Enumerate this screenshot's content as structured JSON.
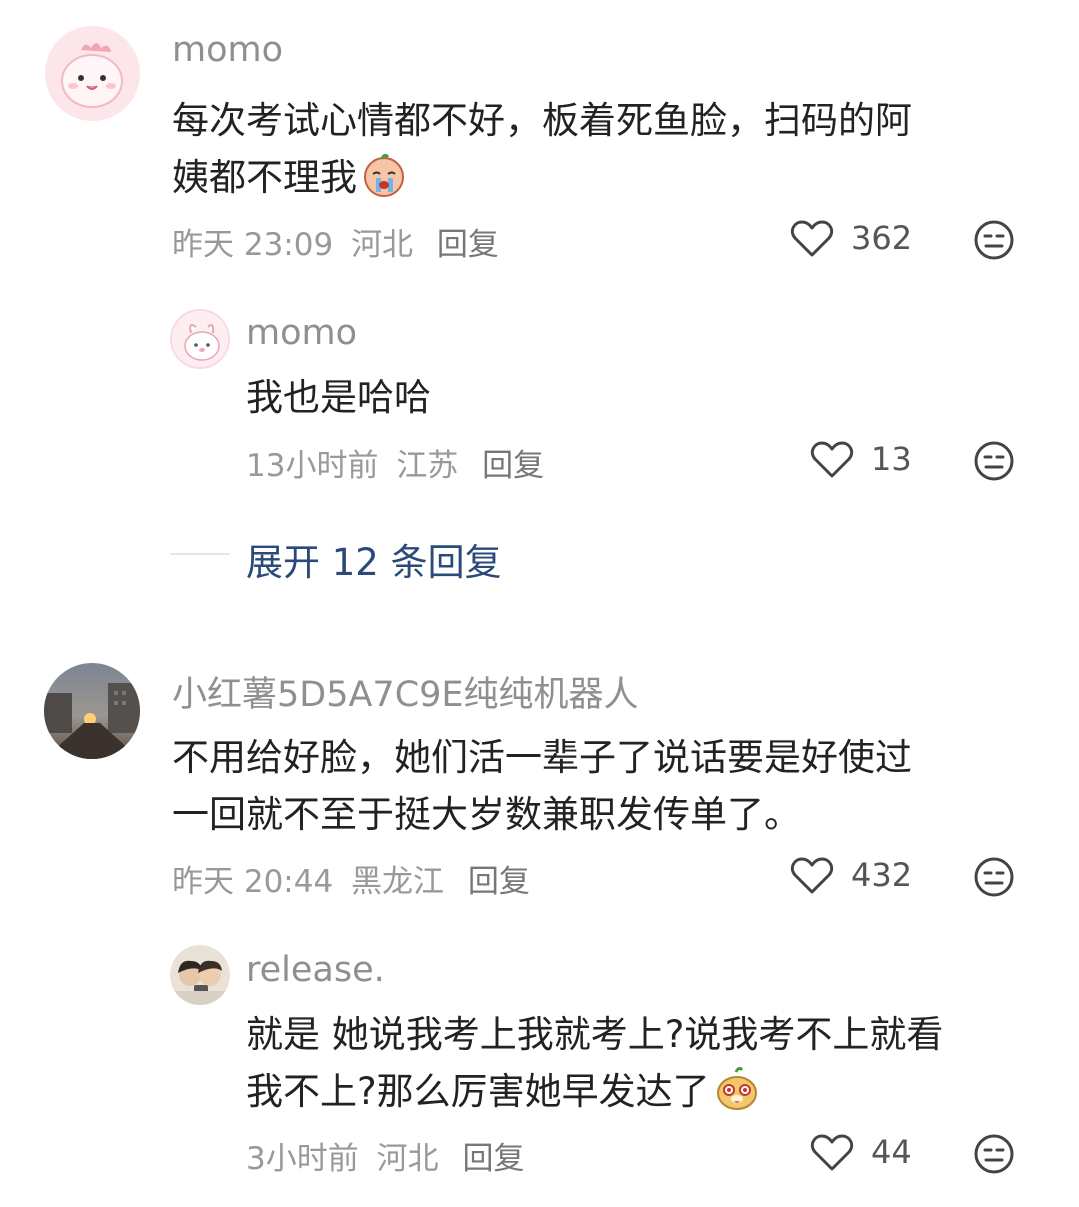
{
  "comments": [
    {
      "username": "momo",
      "text_line1": "每次考试心情都不好，板着死鱼脸，扫码的阿",
      "text_line2": "姨都不理我",
      "time": "昨天 23:09",
      "location": "河北",
      "reply_label": "回复",
      "likes": "362",
      "replies": [
        {
          "username": "momo",
          "text": "我也是哈哈",
          "time": "13小时前",
          "location": "江苏",
          "reply_label": "回复",
          "likes": "13"
        }
      ],
      "expand_label": "展开 12 条回复"
    },
    {
      "username": "小红薯5D5A7C9E纯纯机器人",
      "text_line1": "不用给好脸，她们活一辈子了说话要是好使过",
      "text_line2": "一回就不至于挺大岁数兼职发传单了。",
      "time": "昨天 20:44",
      "location": "黑龙江",
      "reply_label": "回复",
      "likes": "432",
      "replies": [
        {
          "username": "release.",
          "text_line1": "就是 她说我考上我就考上?说我考不上就看",
          "text_line2": "我不上?那么厉害她早发达了",
          "time": "3小时前",
          "location": "河北",
          "reply_label": "回复",
          "likes": "44"
        }
      ]
    }
  ],
  "icons": {
    "like": "heart-outline-icon",
    "reaction": "meh-face-icon"
  },
  "colors": {
    "text": "#222222",
    "meta": "#999999",
    "expand": "#2b4a7a"
  }
}
